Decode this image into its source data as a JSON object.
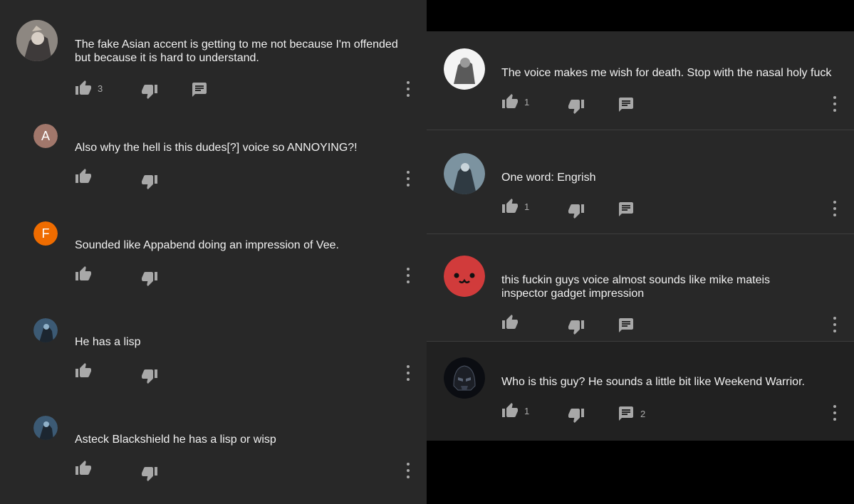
{
  "left_comments": [
    {
      "avatar_letter": "",
      "text": "The fake Asian accent is getting to me not because I'm offended but because it is hard to understand.",
      "likes": "3",
      "replies": ""
    },
    {
      "avatar_letter": "A",
      "text": "Also why the hell is this dudes[?] voice so ANNOYING?!",
      "likes": "",
      "replies": ""
    },
    {
      "avatar_letter": "F",
      "text": "Sounded like Appabend doing an impression of Vee.",
      "likes": "",
      "replies": ""
    },
    {
      "avatar_letter": "",
      "text": "He has a lisp",
      "likes": "",
      "replies": ""
    },
    {
      "avatar_letter": "",
      "text": "Asteck Blackshield he has a lisp or wisp",
      "likes": "",
      "replies": ""
    }
  ],
  "right_comments": [
    {
      "text": "The voice makes me wish for death. Stop with the nasal holy fuck",
      "likes": "1",
      "replies": ""
    },
    {
      "text": "One word: Engrish",
      "likes": "1",
      "replies": ""
    },
    {
      "text": "this fuckin guys voice almost sounds like mike mateis inspector gadget impression",
      "likes": "",
      "replies": ""
    },
    {
      "text": "Who is this guy? He sounds a little bit like Weekend Warrior.",
      "likes": "1",
      "replies": "2"
    }
  ],
  "colors": {
    "avatar_a": "#a1776b",
    "avatar_f": "#ef6c00",
    "avatar_red": "#d13b3b"
  }
}
